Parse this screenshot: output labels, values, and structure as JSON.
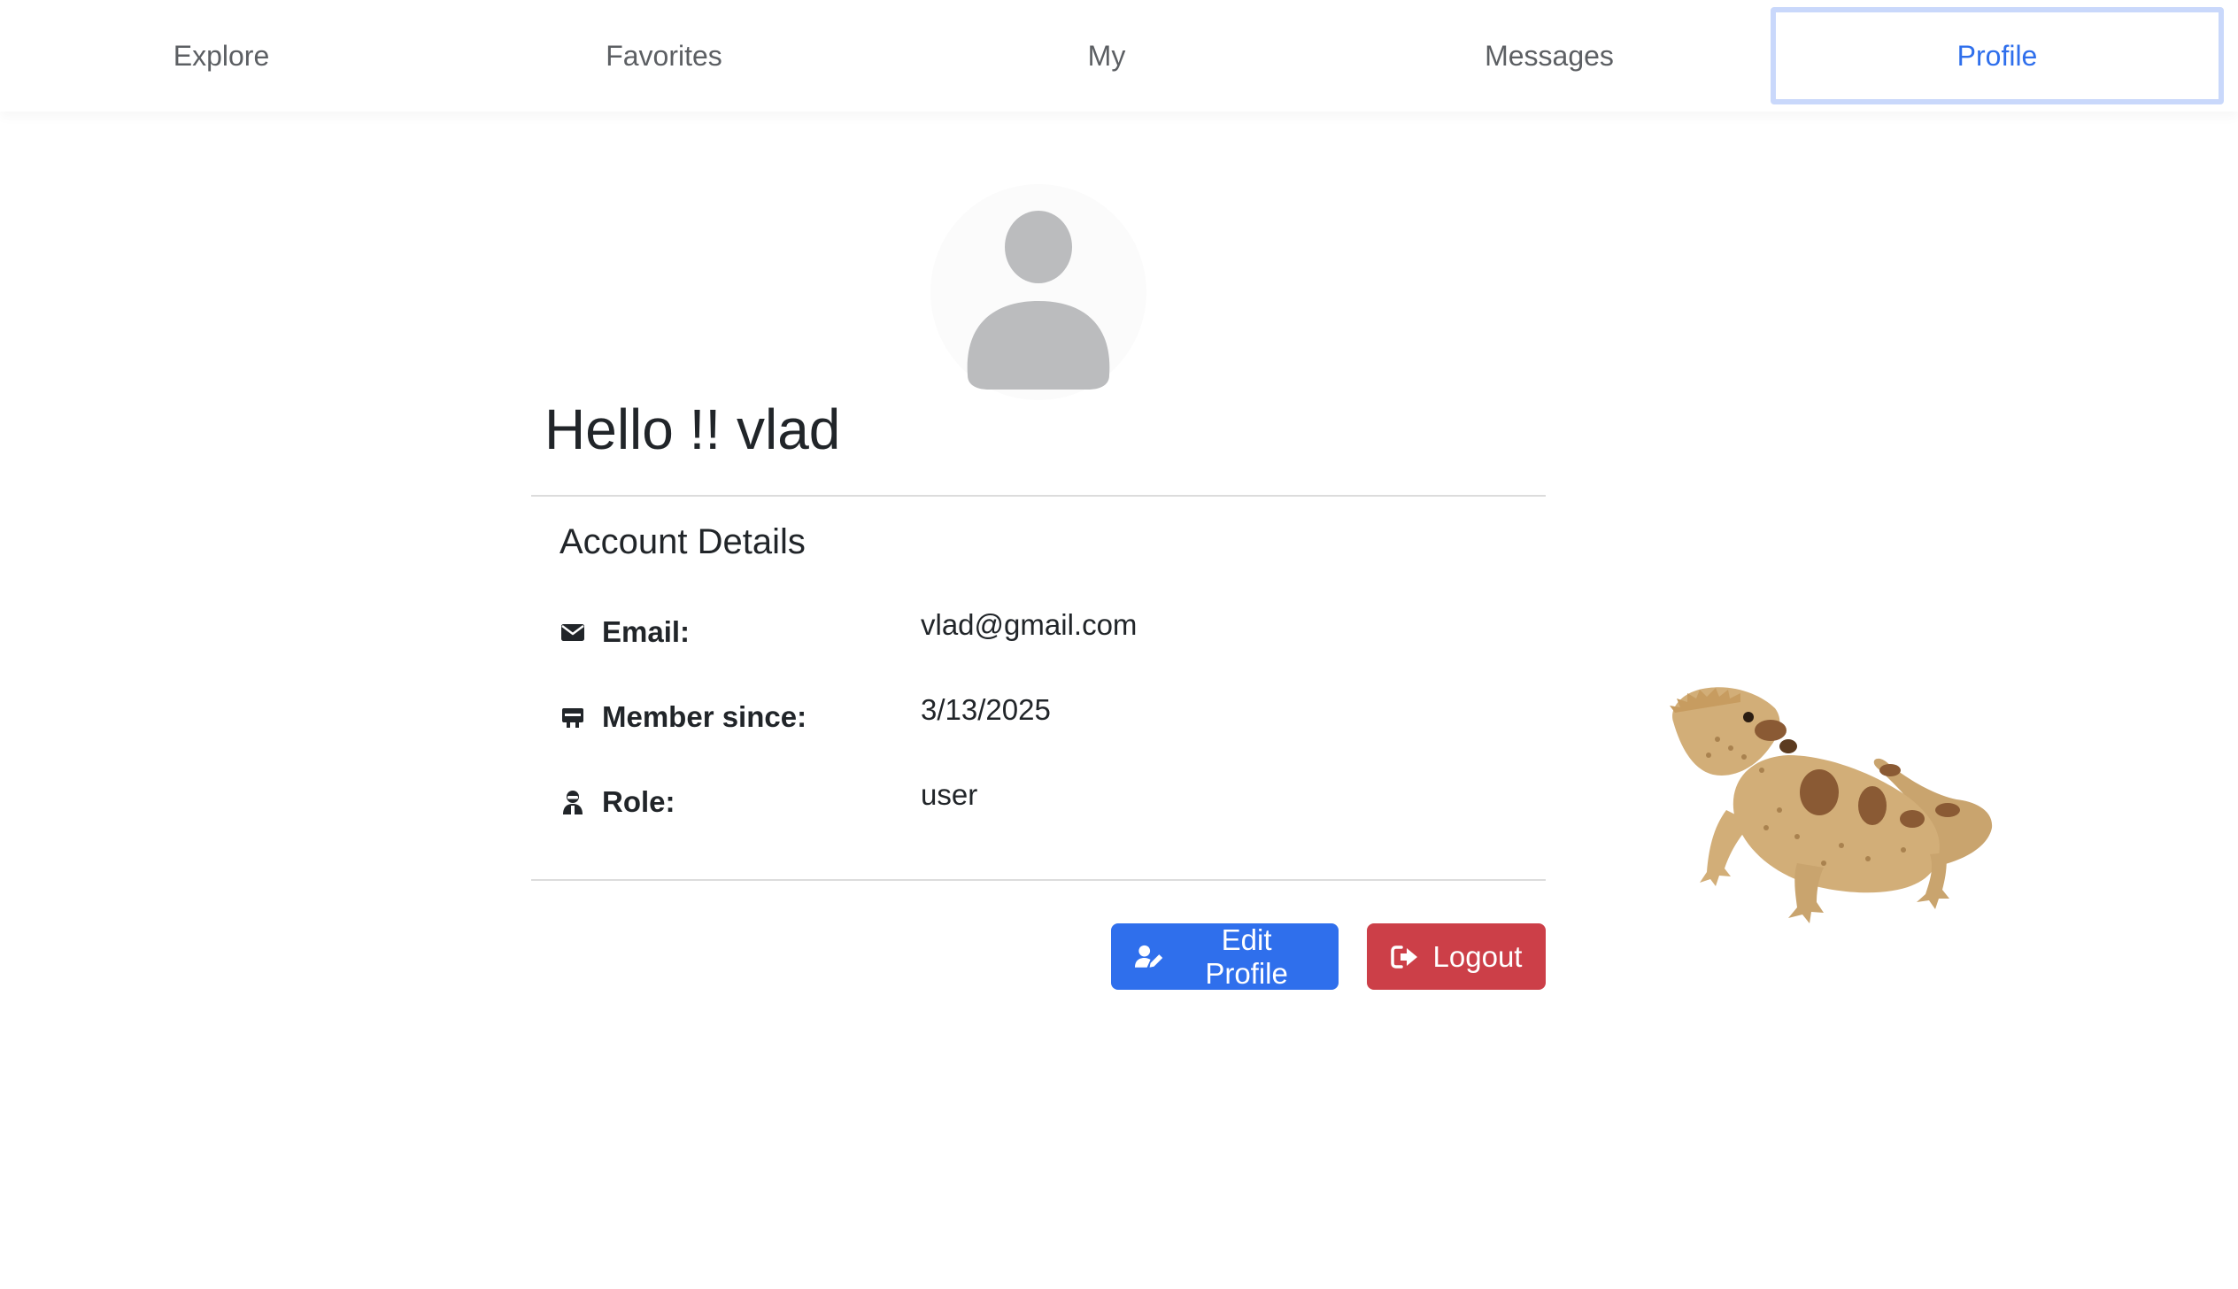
{
  "nav": {
    "items": [
      {
        "label": "Explore"
      },
      {
        "label": "Favorites"
      },
      {
        "label": "My"
      },
      {
        "label": "Messages"
      },
      {
        "label": "Profile"
      }
    ],
    "active": "Profile"
  },
  "profile": {
    "greeting": "Hello !! vlad",
    "avatar_icon": "user-silhouette-icon",
    "account_title": "Account Details",
    "details": [
      {
        "icon": "envelope-icon",
        "label": "Email:",
        "value": "vlad@gmail.com"
      },
      {
        "icon": "calendar-icon",
        "label": "Member since:",
        "value": "3/13/2025"
      },
      {
        "icon": "user-role-icon",
        "label": "Role:",
        "value": "user"
      }
    ]
  },
  "actions": {
    "edit_label": "Edit Profile",
    "edit_icon": "user-edit-icon",
    "logout_label": "Logout",
    "logout_icon": "sign-out-icon"
  },
  "decoration": {
    "image": "lizard-illustration"
  },
  "colors": {
    "primary": "#2f6fec",
    "danger": "#cc3f48",
    "active_outline": "#c9d8fb",
    "nav_text": "#5c5f63",
    "avatar_gray": "#bbbcbe"
  }
}
